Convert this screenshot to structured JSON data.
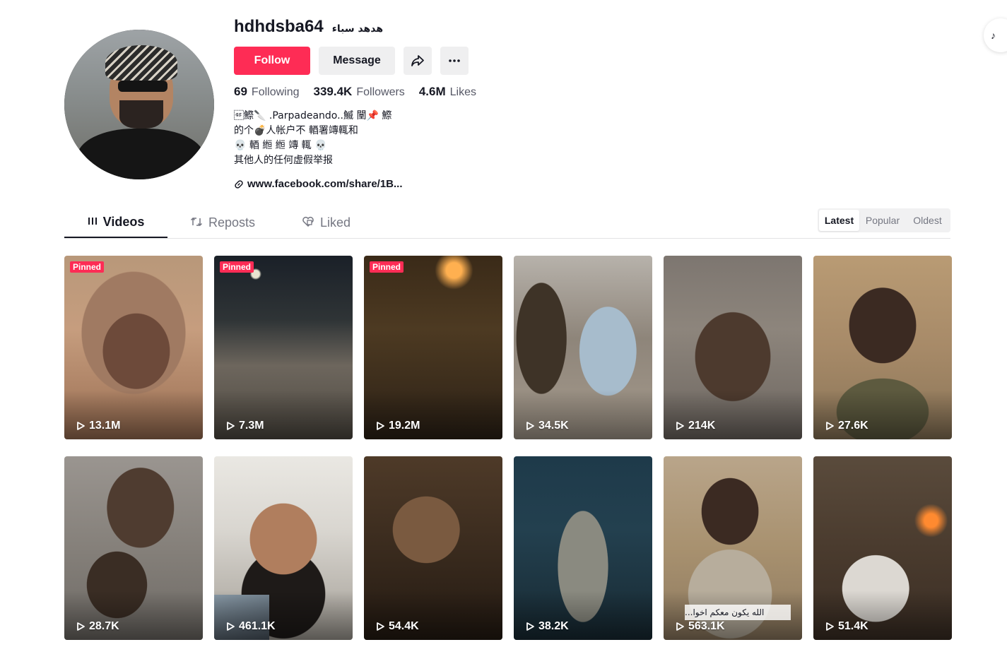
{
  "profile": {
    "username": "hdhdsba64",
    "nickname": "هدهد سباء",
    "follow_label": "Follow",
    "message_label": "Message",
    "stats": [
      {
        "value": "69",
        "label": "Following"
      },
      {
        "value": "339.4K",
        "label": "Followers"
      },
      {
        "value": "4.6M",
        "label": "Likes"
      }
    ],
    "bio_lines": [
      "\u001d鰶🔪 .Parpadeando..鰄 闉📌 鰶",
      "的个💣人帐户不 輏署竱輒和",
      "💀 輏 縆 縆 竱 輒 💀",
      "其他人的任何虚假举报"
    ],
    "link": "www.facebook.com/share/1B..."
  },
  "tabs": [
    {
      "label": "Videos",
      "icon": "grid-icon",
      "active": true
    },
    {
      "label": "Reposts",
      "icon": "repost-icon",
      "active": false
    },
    {
      "label": "Liked",
      "icon": "liked-icon",
      "active": false
    }
  ],
  "sort": {
    "options": [
      "Latest",
      "Popular",
      "Oldest"
    ],
    "selected": "Latest"
  },
  "pinned_label": "Pinned",
  "videos": [
    {
      "views": "13.1M",
      "pinned": true
    },
    {
      "views": "7.3M",
      "pinned": true
    },
    {
      "views": "19.2M",
      "pinned": true
    },
    {
      "views": "34.5K",
      "pinned": false
    },
    {
      "views": "214K",
      "pinned": false
    },
    {
      "views": "27.6K",
      "pinned": false
    },
    {
      "views": "28.7K",
      "pinned": false
    },
    {
      "views": "461.1K",
      "pinned": false
    },
    {
      "views": "54.4K",
      "pinned": false
    },
    {
      "views": "38.2K",
      "pinned": false
    },
    {
      "views": "563.1K",
      "pinned": false,
      "caption": "الله يكون معكم اخوا..."
    },
    {
      "views": "51.4K",
      "pinned": false
    }
  ],
  "colors": {
    "accent": "#fe2c55",
    "text": "#161823",
    "muted": "#757782"
  }
}
